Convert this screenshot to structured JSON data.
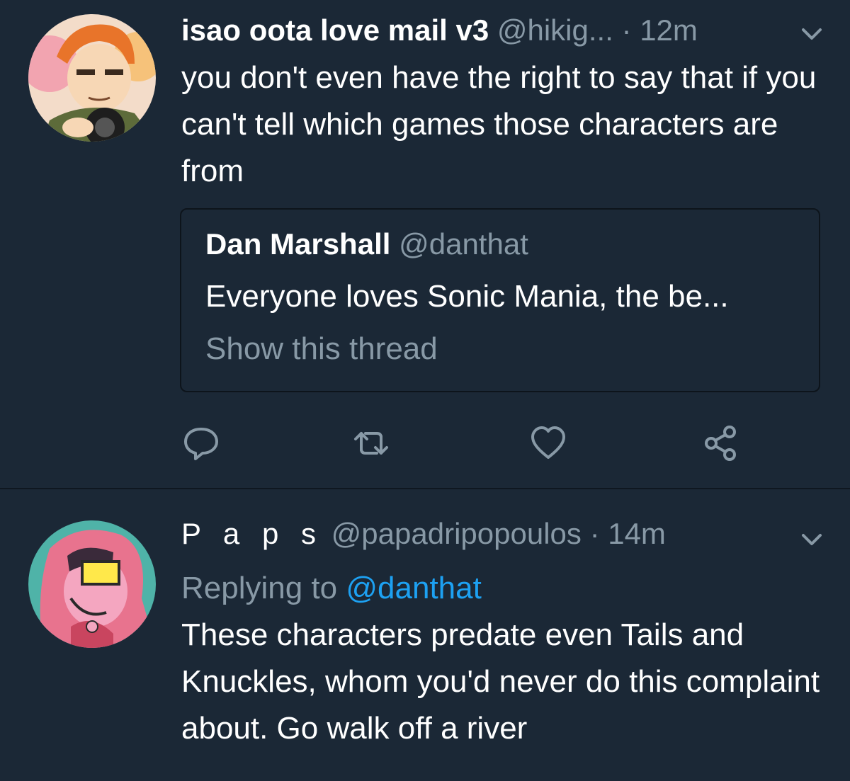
{
  "tweets": [
    {
      "display_name": "isao oota love mail v3",
      "handle": "@hikig...",
      "time": "· 12m",
      "text": "you don't even have the right to say that if you can't tell which games those characters are from",
      "quote": {
        "display_name": "Dan Marshall",
        "handle": "@danthat",
        "text": "Everyone loves Sonic Mania, the be...",
        "show_thread": "Show this thread"
      },
      "actions": [
        "reply-icon",
        "retweet-icon",
        "like-icon",
        "share-icon"
      ]
    },
    {
      "display_name": "P a p s",
      "handle": "@papadripopoulos",
      "time": "· 14m",
      "replying_prefix": "Replying to ",
      "replying_mention": "@danthat",
      "text": "These characters predate even Tails and Knuckles, whom you'd never do this complaint about. Go walk off a river"
    }
  ],
  "colors": {
    "background": "#1b2836",
    "secondary_text": "#8899a6",
    "link": "#1da1f2",
    "divider": "#0f1720"
  }
}
